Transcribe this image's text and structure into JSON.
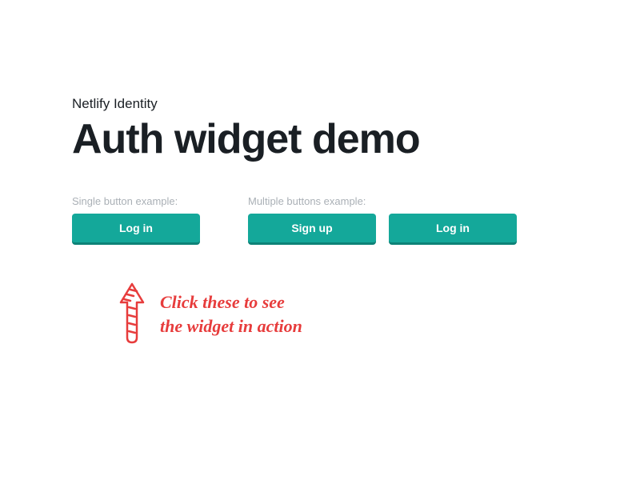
{
  "header": {
    "subtitle": "Netlify Identity",
    "title": "Auth widget demo"
  },
  "examples": {
    "single": {
      "label": "Single button example:",
      "button": "Log in"
    },
    "multiple": {
      "label": "Multiple buttons example:",
      "buttons": [
        "Sign up",
        "Log in"
      ]
    }
  },
  "annotation": {
    "text": "Click these to see\nthe widget in action",
    "arrow": "up-arrow-sketched",
    "color": "#e73c3c"
  }
}
